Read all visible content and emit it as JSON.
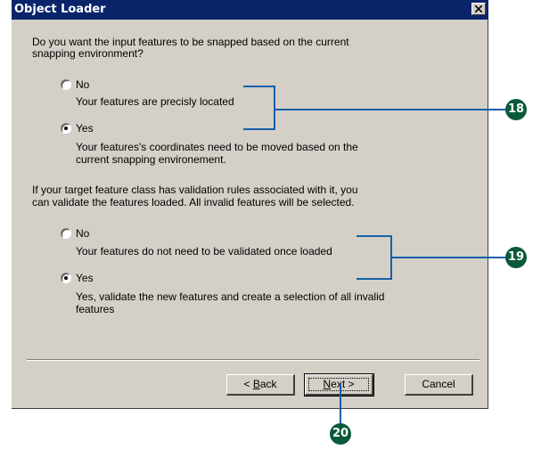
{
  "window": {
    "title": "Object Loader",
    "close_icon": "close-icon"
  },
  "snapping": {
    "question_line1": "Do you want the input features to be snapped based on the current",
    "question_line2": "snapping environment?",
    "no_label": "No",
    "no_desc": "Your features are precisly located",
    "no_selected": false,
    "yes_label": "Yes",
    "yes_desc_line1": "Your features's coordinates need to be moved based on the",
    "yes_desc_line2": "current snapping environement.",
    "yes_selected": true
  },
  "validation": {
    "question_line1": "If your target feature class has validation rules associated with it, you",
    "question_line2": "can validate the features loaded. All invalid features will be selected.",
    "no_label": "No",
    "no_desc": "Your features do not need to be validated once loaded",
    "no_selected": false,
    "yes_label": "Yes",
    "yes_desc_line1": "Yes, validate the new features and create a selection of all invalid",
    "yes_desc_line2": "features",
    "yes_selected": true
  },
  "buttons": {
    "back": {
      "before": "< ",
      "mnemonic": "B",
      "after": "ack"
    },
    "next": {
      "before": "",
      "mnemonic": "N",
      "after": "ext >"
    },
    "cancel": "Cancel"
  },
  "callouts": [
    "18",
    "19",
    "20"
  ],
  "colors": {
    "title_bar": "#0a246a",
    "dialog_face": "#d4d0c8",
    "callout_line": "#1560a8",
    "callout_badge": "#0a5a3a"
  }
}
